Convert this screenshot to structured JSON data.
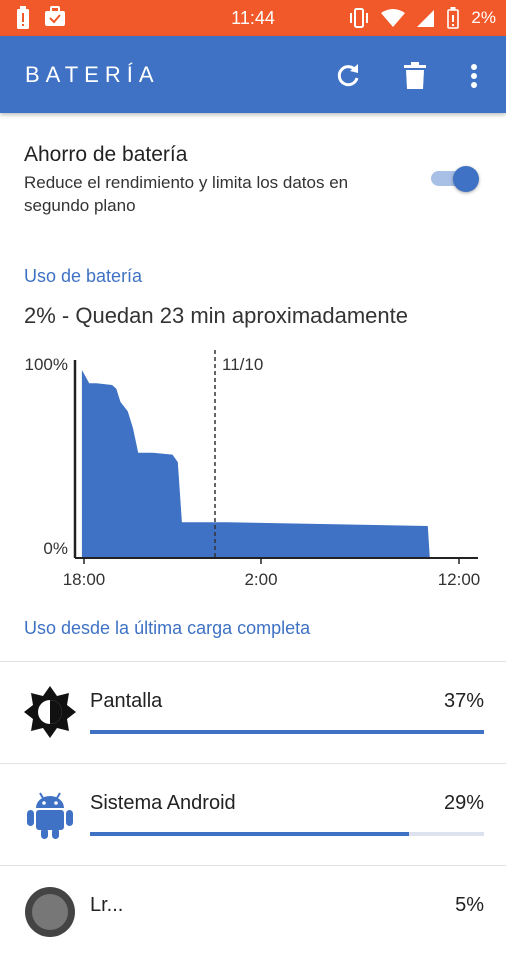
{
  "status_bar": {
    "time": "11:44",
    "battery_percent": "2%",
    "left_icons": [
      "battery-alert-icon",
      "briefcase-check-icon"
    ],
    "right_icons": [
      "vibrate-icon",
      "wifi-icon",
      "cell-signal-icon",
      "battery-low-icon"
    ]
  },
  "app_bar": {
    "title": "BATERÍA",
    "actions": [
      "refresh-icon",
      "trash-icon",
      "more-vert-icon"
    ],
    "color": "#3f72c4"
  },
  "battery_saver": {
    "title": "Ahorro de batería",
    "subtitle": "Reduce el rendimiento y limita los datos en segundo plano",
    "enabled": true
  },
  "battery_usage": {
    "header": "Uso de batería",
    "summary": "2% - Quedan 23 min aproximadamente"
  },
  "chart_data": {
    "type": "area",
    "y_top_label": "100%",
    "y_bottom_label": "0%",
    "x_tick_labels": [
      "18:00",
      "2:00",
      "12:00"
    ],
    "day_marker_label": "11/10",
    "ylim": [
      0,
      100
    ],
    "x_hours_since_first_tick": [
      -0.1,
      0.0,
      0.25,
      0.6,
      1.35,
      1.55,
      1.75,
      2.1,
      2.35,
      2.6,
      2.9,
      3.3,
      4.25,
      4.5,
      4.7,
      6.6,
      6.9,
      16.5,
      16.6
    ],
    "y_percent": [
      100,
      98,
      93,
      93,
      92,
      90,
      83,
      78,
      69,
      56,
      56,
      56,
      55,
      51,
      19,
      19,
      19,
      17,
      0
    ],
    "color": "#3f72c4"
  },
  "since_full_charge": {
    "header": "Uso desde la última carga completa",
    "apps": [
      {
        "name": "Pantalla",
        "percent_label": "37%",
        "fraction": 1.0,
        "icon": "brightness-icon"
      },
      {
        "name": "Sistema Android",
        "percent_label": "29%",
        "fraction": 0.81,
        "icon": "android-icon"
      },
      {
        "name": "Lr...",
        "percent_label": "5%",
        "icon": "app-avatar-icon"
      }
    ]
  }
}
